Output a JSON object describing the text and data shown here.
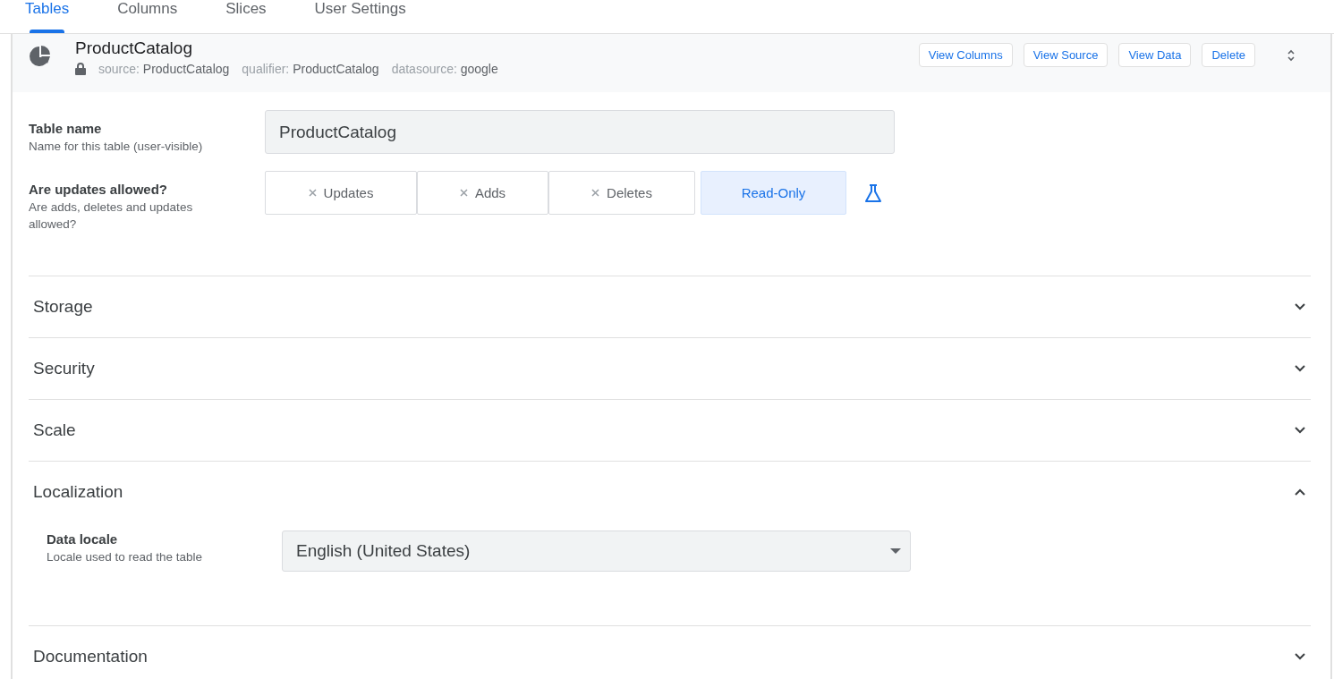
{
  "tabs": [
    {
      "label": "Tables",
      "selected": true
    },
    {
      "label": "Columns",
      "selected": false
    },
    {
      "label": "Slices",
      "selected": false
    },
    {
      "label": "User Settings",
      "selected": false
    }
  ],
  "table_header": {
    "title": "ProductCatalog",
    "locked": true,
    "meta": [
      {
        "key": "source:",
        "value": "ProductCatalog"
      },
      {
        "key": "qualifier:",
        "value": "ProductCatalog"
      },
      {
        "key": "datasource:",
        "value": "google"
      }
    ],
    "buttons": [
      "View Columns",
      "View Source",
      "View Data",
      "Delete"
    ]
  },
  "table_name": {
    "label": "Table name",
    "hint": "Name for this table (user-visible)",
    "value": "ProductCatalog"
  },
  "updates": {
    "label": "Are updates allowed?",
    "hint": "Are adds, deletes and updates allowed?",
    "options": [
      {
        "label": "Updates",
        "kind": "toggle",
        "selected": false
      },
      {
        "label": "Adds",
        "kind": "toggle",
        "selected": false
      },
      {
        "label": "Deletes",
        "kind": "toggle",
        "selected": false
      },
      {
        "label": "Read-Only",
        "kind": "mode",
        "selected": true
      }
    ]
  },
  "sections": [
    {
      "title": "Storage",
      "expanded": false
    },
    {
      "title": "Security",
      "expanded": false
    },
    {
      "title": "Scale",
      "expanded": false
    },
    {
      "title": "Localization",
      "expanded": true,
      "fields": [
        {
          "label": "Data locale",
          "hint": "Locale used to read the table",
          "value": "English (United States)"
        }
      ]
    },
    {
      "title": "Documentation",
      "expanded": false
    }
  ]
}
